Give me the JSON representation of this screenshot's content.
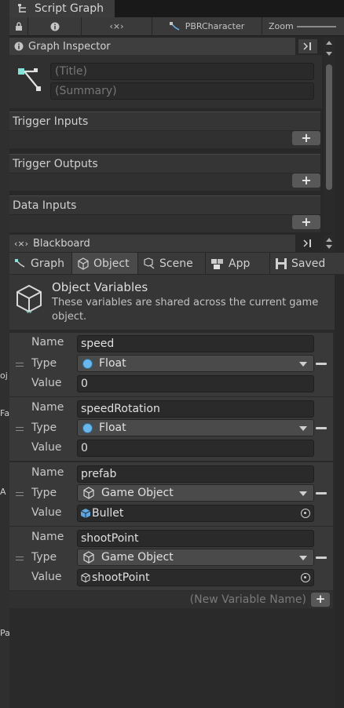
{
  "window": {
    "title": "Script Graph"
  },
  "toolbar": {
    "info_icon": "info-icon",
    "var_label": "‹×›",
    "graph_name": "PBRCharacter",
    "zoom_label": "Zoom"
  },
  "inspector": {
    "header": "Graph Inspector",
    "title_placeholder": "(Title)",
    "summary_placeholder": "(Summary)"
  },
  "sections": {
    "trigger_inputs": "Trigger Inputs",
    "trigger_outputs": "Trigger Outputs",
    "data_inputs": "Data Inputs"
  },
  "blackboard": {
    "header": "Blackboard",
    "tabs": [
      "Graph",
      "Object",
      "Scene",
      "App",
      "Saved"
    ],
    "active_tab": "Object",
    "title": "Object Variables",
    "description": "These variables are shared across the current game object.",
    "labels": {
      "name": "Name",
      "type": "Type",
      "value": "Value"
    },
    "variables": [
      {
        "name": "speed",
        "type": "Float",
        "value": "0"
      },
      {
        "name": "speedRotation",
        "type": "Float",
        "value": "0"
      },
      {
        "name": "prefab",
        "type": "Game Object",
        "value": "Bullet"
      },
      {
        "name": "shootPoint",
        "type": "Game Object",
        "value": "shootPoint"
      }
    ],
    "new_var_placeholder": "(New Variable Name)"
  },
  "left_strip": [
    "oj",
    "Fa",
    "A",
    "Pa"
  ],
  "colors": {
    "accent": "#66b8ee",
    "plus": "#585858"
  }
}
